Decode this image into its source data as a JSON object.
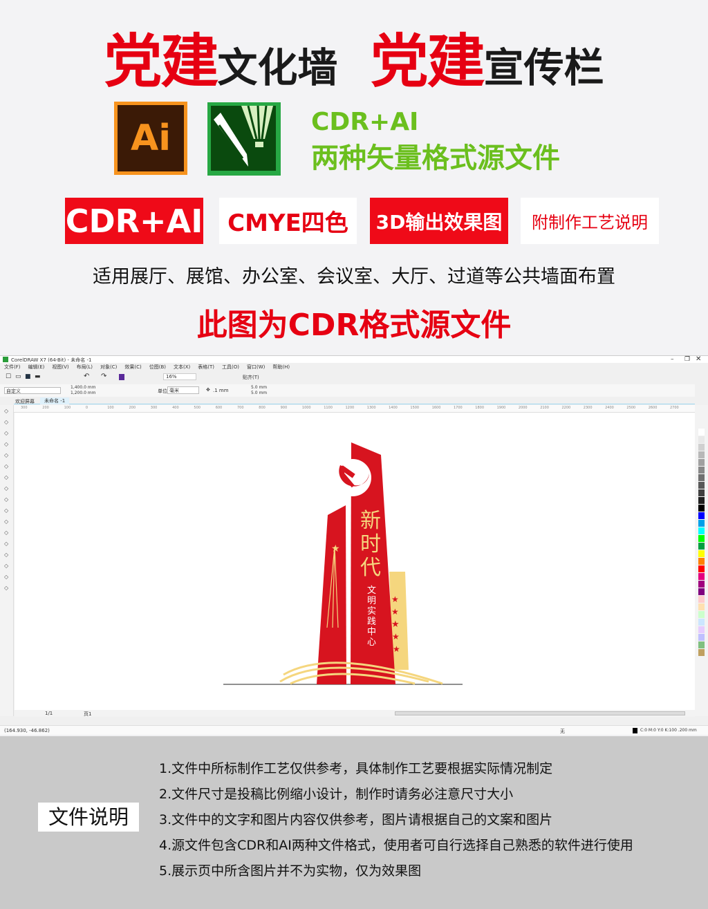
{
  "header": {
    "title_red_1": "党建",
    "title_black_1": "文化墙",
    "title_red_2": "党建",
    "title_black_2": "宣传栏"
  },
  "formats": {
    "ai_logo": "Ai",
    "line1": "CDR+AI",
    "line2": "两种矢量格式源文件"
  },
  "tags": [
    "CDR+AI",
    "CMYE四色",
    "3D输出效果图",
    "附制作工艺说明"
  ],
  "usage": "适用展厅、展馆、办公室、会议室、大厅、过道等公共墙面布置",
  "notice": "此图为CDR格式源文件",
  "app": {
    "title": "CorelDRAW X7 (64-Bit) - 未命名 -1",
    "menu": [
      "文件(F)",
      "编辑(E)",
      "视图(V)",
      "布局(L)",
      "对象(C)",
      "效果(C)",
      "位图(B)",
      "文本(X)",
      "表格(T)",
      "工具(O)",
      "窗口(W)",
      "帮助(H)"
    ],
    "zoom": "16%",
    "snap": "贴齐(T)",
    "page_preset": "自定义",
    "width": "1,400.0 mm",
    "height": "1,200.0 mm",
    "units_label": "单位:",
    "units": "毫米",
    "nudge": ".1 mm",
    "dup_x": "5.0 mm",
    "dup_y": "5.0 mm",
    "tabs": [
      "欢迎屏幕",
      "未命名 -1"
    ],
    "ruler_ticks": [
      "300",
      "200",
      "100",
      "0",
      "100",
      "200",
      "300",
      "400",
      "500",
      "600",
      "700",
      "800",
      "900",
      "1000",
      "1100",
      "1200",
      "1300",
      "1400",
      "1500",
      "1600",
      "1700",
      "1800",
      "1900",
      "2000",
      "2100",
      "2200",
      "2300",
      "2400",
      "2500",
      "2600",
      "2700"
    ],
    "page_nav": "1/1",
    "page_tab": "页1",
    "coords": "(164.930, -46.862)",
    "fill_none": "无",
    "outline": "C:0 M:0 Y:0 K:100  .200 mm",
    "palette": [
      "#ffffff",
      "#e8e8e8",
      "#d0d0d0",
      "#b8b8b8",
      "#a0a0a0",
      "#888888",
      "#707070",
      "#585858",
      "#404040",
      "#202020",
      "#000000",
      "#0000ff",
      "#00a0e9",
      "#00ffff",
      "#00ff00",
      "#00a040",
      "#ffff00",
      "#ff8000",
      "#ff0000",
      "#e4007f",
      "#a0007f",
      "#7f007f",
      "#ffcccc",
      "#ffe0b0",
      "#ccffcc",
      "#cce6ff",
      "#e6ccff",
      "#c0c0ff",
      "#80c080",
      "#c0a060"
    ]
  },
  "artwork": {
    "headline": "新时代",
    "subtitle": "文明实践中心",
    "red": "#d7141f",
    "gold": "#f5d67e"
  },
  "notes": {
    "label": "文件说明",
    "items": [
      "1.文件中所标制作工艺仅供参考，具体制作工艺要根据实际情况制定",
      "2.文件尺寸是投稿比例缩小设计，制作时请务必注意尺寸大小",
      "3.文件中的文字和图片内容仅供参考，图片请根据自己的文案和图片",
      "4.源文件包含CDR和AI两种文件格式，使用者可自行选择自己熟悉的软件进行使用",
      "5.展示页中所含图片并不为实物，仅为效果图"
    ]
  }
}
